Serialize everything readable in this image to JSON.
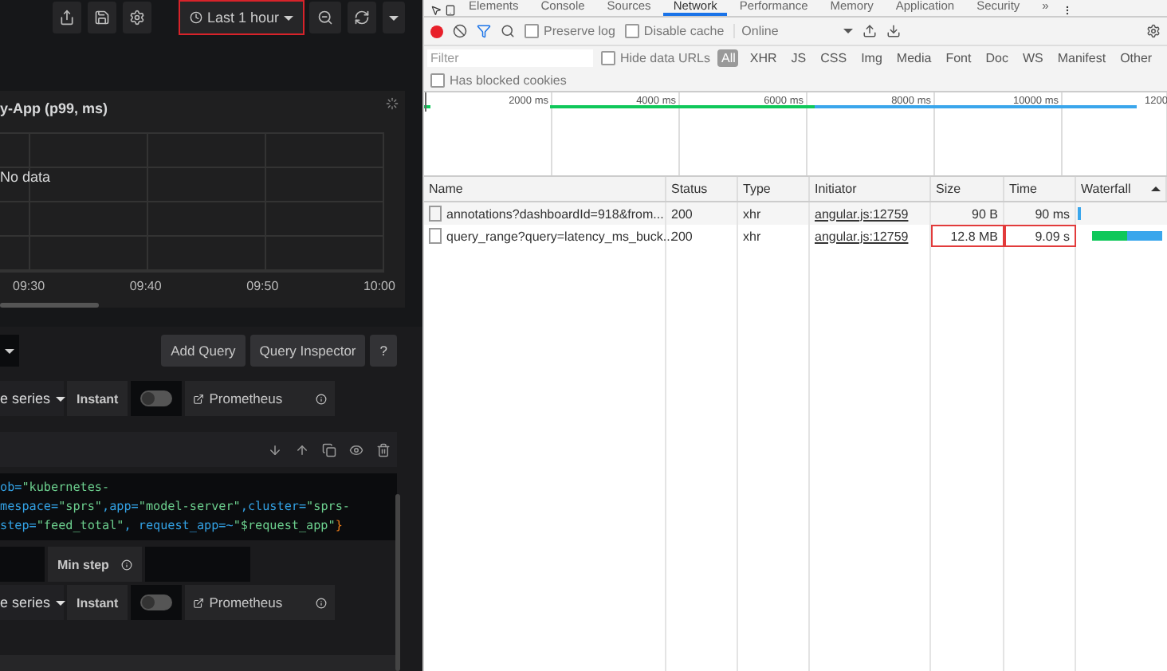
{
  "dashboard": {
    "time_range": {
      "label": "Last 1 hour",
      "highlighted": true
    },
    "panel": {
      "title": "y-App (p99, ms)",
      "message": "No data",
      "x_labels": [
        "09:30",
        "09:40",
        "09:50",
        "10:00"
      ]
    },
    "query_toolbar": {
      "buttons": [
        "Add Query",
        "Query Inspector",
        "?"
      ]
    },
    "queries": [
      {
        "format": "e series",
        "instant_label": "Instant",
        "instant": false,
        "datasource": "Prometheus"
      },
      {
        "code": [
          [
            {
              "kind": "key",
              "text": "ob="
            },
            {
              "kind": "string",
              "text": "\"kubernetes-"
            }
          ],
          [
            {
              "kind": "key",
              "text": "mespace="
            },
            {
              "kind": "string",
              "text": "\"sprs\""
            },
            {
              "kind": "key",
              "text": ",app="
            },
            {
              "kind": "string",
              "text": "\"model-server\""
            },
            {
              "kind": "key",
              "text": ",cluster="
            },
            {
              "kind": "string",
              "text": "\"sprs-"
            }
          ],
          [
            {
              "kind": "key",
              "text": "step="
            },
            {
              "kind": "string",
              "text": "\"feed_total\""
            },
            {
              "kind": "key",
              "text": ", request_app=~"
            },
            {
              "kind": "string",
              "text": "\"$request_app\""
            },
            {
              "kind": "brace",
              "text": "}"
            }
          ]
        ],
        "min_step_label": "Min step",
        "format": "e series",
        "instant_label": "Instant",
        "instant": false,
        "datasource": "Prometheus"
      }
    ]
  },
  "devtools": {
    "tabs": [
      {
        "label": "Elements",
        "selected": false
      },
      {
        "label": "Console",
        "selected": false
      },
      {
        "label": "Sources",
        "selected": false
      },
      {
        "label": "Network",
        "selected": true
      },
      {
        "label": "Performance",
        "selected": false
      },
      {
        "label": "Memory",
        "selected": false
      },
      {
        "label": "Application",
        "selected": false
      },
      {
        "label": "Security",
        "selected": false
      }
    ],
    "overflow": "»",
    "toolbar": {
      "recording": true,
      "preserve_log": {
        "label": "Preserve log",
        "checked": false
      },
      "disable_cache": {
        "label": "Disable cache",
        "checked": false
      },
      "throttling": "Online"
    },
    "filter": {
      "placeholder": "Filter",
      "hide_data_urls": {
        "label": "Hide data URLs",
        "checked": false
      },
      "types": [
        {
          "label": "All",
          "selected": true
        },
        {
          "label": "XHR",
          "selected": false
        },
        {
          "label": "JS",
          "selected": false
        },
        {
          "label": "CSS",
          "selected": false
        },
        {
          "label": "Img",
          "selected": false
        },
        {
          "label": "Media",
          "selected": false
        },
        {
          "label": "Font",
          "selected": false
        },
        {
          "label": "Doc",
          "selected": false
        },
        {
          "label": "WS",
          "selected": false
        },
        {
          "label": "Manifest",
          "selected": false
        },
        {
          "label": "Other",
          "selected": false
        }
      ]
    },
    "blocked_cookies": {
      "label": "Has blocked cookies",
      "checked": false
    },
    "overview": {
      "ticks": [
        "2000 ms",
        "4000 ms",
        "6000 ms",
        "8000 ms",
        "10000 ms",
        "1200"
      ]
    },
    "table": {
      "columns": [
        "Name",
        "Status",
        "Type",
        "Initiator",
        "Size",
        "Time",
        "Waterfall"
      ],
      "rows": [
        {
          "name": "annotations?dashboardId=918&from...",
          "status": "200",
          "type": "xhr",
          "initiator": "angular.js:12759",
          "size": "90 B",
          "time": "90 ms",
          "size_highlighted": false,
          "time_highlighted": false,
          "waterfall": {
            "kind": "short"
          }
        },
        {
          "name": "query_range?query=latency_ms_buck...",
          "status": "200",
          "type": "xhr",
          "initiator": "angular.js:12759",
          "size": "12.8 MB",
          "time": "9.09 s",
          "size_highlighted": true,
          "time_highlighted": true,
          "waterfall": {
            "kind": "long"
          }
        }
      ]
    }
  }
}
